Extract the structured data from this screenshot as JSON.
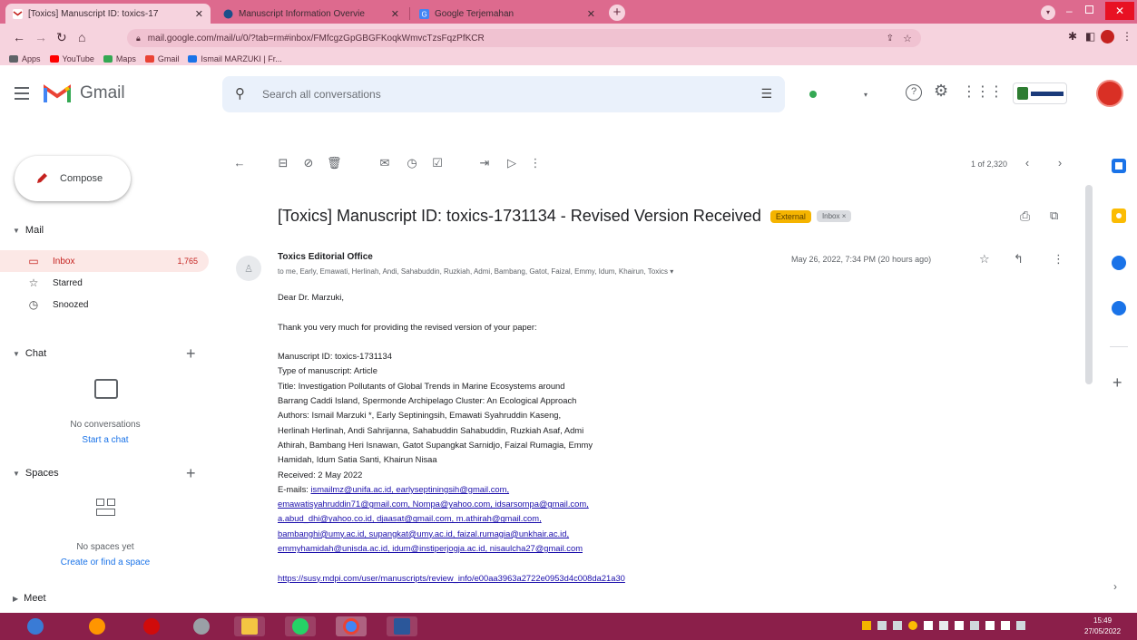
{
  "browser": {
    "tabs": [
      {
        "title": "[Toxics] Manuscript ID: toxics-17",
        "favicon_color": "#c5221f",
        "active": true
      },
      {
        "title": "Manuscript Information Overvie",
        "favicon_color": "#1a4f8a",
        "active": false
      },
      {
        "title": "Google Terjemahan",
        "favicon_color": "#4285f4",
        "active": false
      }
    ],
    "new_tab": "+",
    "url": "mail.google.com/mail/u/0/?tab=rm#inbox/FMfcgzGpGBGFKoqkWmvcTzsFqzPfKCR",
    "bookmarks": [
      {
        "label": "Apps",
        "color": "#5f6368"
      },
      {
        "label": "YouTube",
        "color": "#ff0000"
      },
      {
        "label": "Maps",
        "color": "#34a853"
      },
      {
        "label": "Gmail",
        "color": "#ea4335"
      },
      {
        "label": "Ismail MARZUKI | Fr...",
        "color": "#1a73e8"
      }
    ]
  },
  "gmail": {
    "brand": "Gmail",
    "search_placeholder": "Search all conversations",
    "compose_label": "Compose",
    "mail_section": "Mail",
    "nav": [
      {
        "label": "Inbox",
        "count": "1,765",
        "icon": "inbox-icon",
        "active": true
      },
      {
        "label": "Starred",
        "count": "",
        "icon": "star-icon",
        "active": false
      },
      {
        "label": "Snoozed",
        "count": "",
        "icon": "clock-icon",
        "active": false
      }
    ],
    "chat_section": "Chat",
    "chat_empty": "No conversations",
    "chat_link": "Start a chat",
    "spaces_section": "Spaces",
    "spaces_empty": "No spaces yet",
    "spaces_link": "Create or find a space",
    "meet_section": "Meet",
    "pager": "1 of 2,320"
  },
  "message": {
    "subject": "[Toxics] Manuscript ID: toxics-1731134 - Revised Version Received",
    "label_external": "External",
    "label_inbox": "Inbox ×",
    "sender": "Toxics Editorial Office",
    "recipients": "to me, Early, Emawati, Herlinah, Andi, Sahabuddin, Ruzkiah, Admi, Bambang, Gatot, Faizal, Emmy, Idum, Khairun, Toxics ▾",
    "date": "May 26, 2022, 7:34 PM (20 hours ago)",
    "greeting": "Dear Dr. Marzuki,",
    "intro": "Thank you very much for providing the revised version of your paper:",
    "details": [
      "Manuscript ID: toxics-1731134",
      "Type of manuscript: Article",
      "Title: Investigation Pollutants of Global Trends in Marine Ecosystems around",
      "Barrang Caddi Island, Spermonde Archipelago Cluster: An Ecological Approach",
      "Authors: Ismail Marzuki *, Early Septiningsih, Emawati Syahruddin Kaseng,",
      "Herlinah Herlinah, Andi Sahrijanna, Sahabuddin Sahabuddin, Ruzkiah Asaf, Admi",
      "Athirah, Bambang Heri Isnawan, Gatot Supangkat Sarnidjo, Faizal Rumagia, Emmy",
      "Hamidah, Idum Satia Santi, Khairun Nisaa",
      "Received: 2 May 2022"
    ],
    "emails_label": "E-mails:",
    "emails": [
      "ismailmz@unifa.ac.id, earlyseptiningsih@gmail.com,",
      "emawatisyahruddin71@gmail.com, Nompa@yahoo.com, idsarsompa@gmail.com,",
      "a.abud_dhi@yahoo.co.id, djaasat@gmail.com, m.athirah@gmail.com,",
      "bambanghi@umy.ac.id, supangkat@umy.ac.id, faizal.rumagia@unkhair.ac.id,",
      "emmyhamidah@unisda.ac.id, idum@instiperjogja.ac.id, nisaulcha27@gmail.com"
    ],
    "review_link": "https://susy.mdpi.com/user/manuscripts/review_info/e00aa3963a2722e0953d4c008da21a30"
  },
  "taskbar": {
    "apps": [
      {
        "name": "windows",
        "color": "#3a7bd5"
      },
      {
        "name": "firefox",
        "color": "#ff9500"
      },
      {
        "name": "opera",
        "color": "#d00b0b"
      },
      {
        "name": "settings",
        "color": "#9aa0a6"
      },
      {
        "name": "explorer",
        "color": "#f4c542"
      },
      {
        "name": "whatsapp",
        "color": "#25d366"
      },
      {
        "name": "chrome",
        "color": "#4285f4"
      },
      {
        "name": "word",
        "color": "#2b579a"
      }
    ],
    "time": "15:49",
    "date": "27/05/2022"
  }
}
